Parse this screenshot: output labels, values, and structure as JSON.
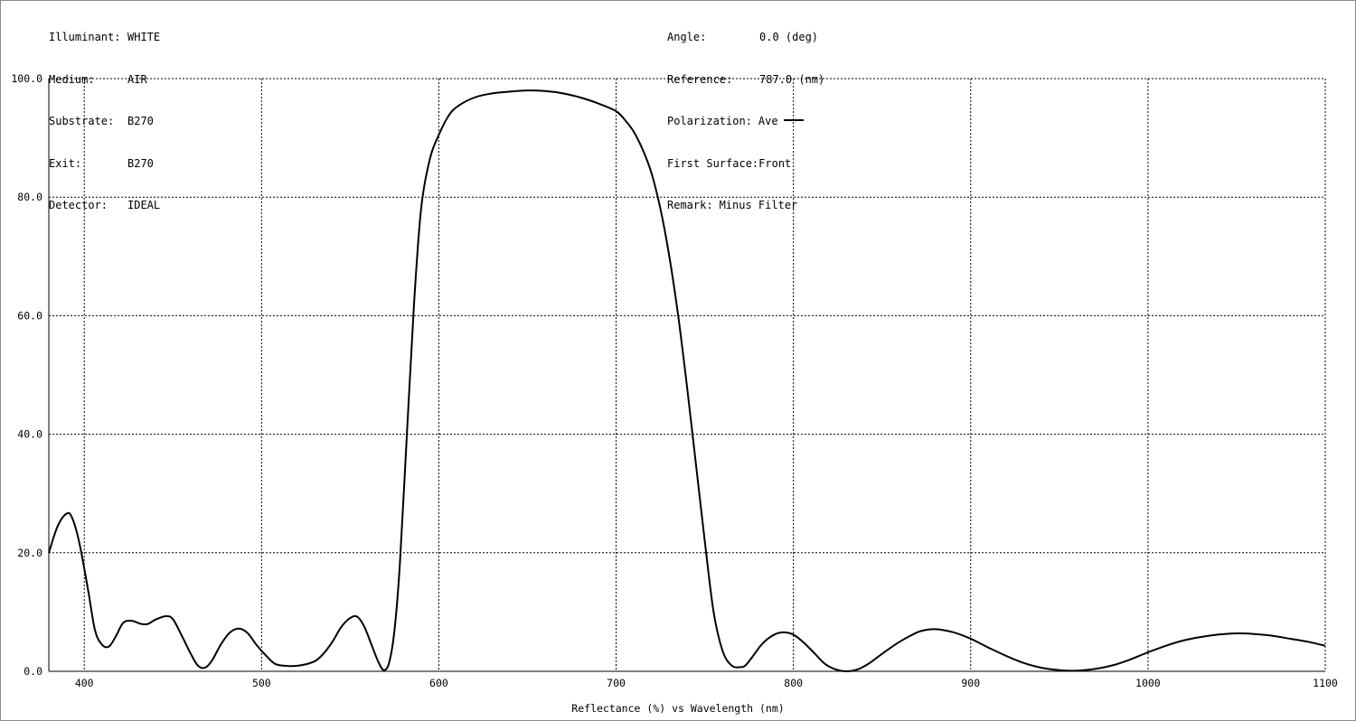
{
  "header_left": [
    {
      "key": "Illuminant:",
      "value": "WHITE"
    },
    {
      "key": "Medium:",
      "value": "AIR"
    },
    {
      "key": "Substrate:",
      "value": "B270"
    },
    {
      "key": "Exit:",
      "value": "B270"
    },
    {
      "key": "Detector:",
      "value": "IDEAL"
    }
  ],
  "header_right": {
    "angle": {
      "key": "Angle:",
      "value": "0.0 (deg)"
    },
    "reference": {
      "key": "Reference:",
      "value": "787.0 (nm)"
    },
    "polarization": {
      "key": "Polarization:",
      "value": "Ave"
    },
    "first_surface": {
      "key": "First Surface:",
      "value": "Front"
    },
    "remark": {
      "key": "Remark:",
      "value": "Minus Filter"
    }
  },
  "chart_data": {
    "type": "line",
    "xlabel": "Reflectance (%)  vs  Wavelength (nm)",
    "ylabel": "",
    "xlim": [
      380,
      1100
    ],
    "ylim": [
      0,
      100
    ],
    "x_ticks": [
      400,
      500,
      600,
      700,
      800,
      900,
      1000,
      1100
    ],
    "y_ticks": [
      0,
      20,
      40,
      60,
      80,
      100
    ],
    "y_tick_labels": [
      "0.0",
      "20.0",
      "40.0",
      "60.0",
      "80.0",
      "100.0"
    ],
    "grid": true,
    "line_color": "#000000",
    "series": [
      {
        "name": "Ave",
        "x": [
          380,
          385,
          390,
          393,
          397,
          402,
          406,
          410,
          414,
          418,
          422,
          427,
          432,
          436,
          440,
          446,
          450,
          455,
          460,
          464,
          468,
          472,
          477,
          482,
          487,
          492,
          497,
          503,
          508,
          515,
          522,
          530,
          535,
          540,
          545,
          550,
          554,
          558,
          562,
          566,
          569,
          572,
          575,
          578,
          582,
          586,
          590,
          595,
          600,
          605,
          610,
          620,
          630,
          640,
          650,
          660,
          670,
          680,
          690,
          700,
          705,
          710,
          715,
          720,
          725,
          730,
          735,
          740,
          745,
          750,
          755,
          760,
          765,
          770,
          773,
          777,
          782,
          787,
          792,
          797,
          801,
          806,
          812,
          818,
          824,
          830,
          836,
          842,
          848,
          854,
          860,
          866,
          872,
          880,
          890,
          900,
          910,
          920,
          930,
          940,
          950,
          960,
          970,
          980,
          990,
          1000,
          1010,
          1020,
          1030,
          1040,
          1050,
          1060,
          1070,
          1080,
          1090,
          1100
        ],
        "y": [
          20.0,
          24.5,
          26.6,
          26.0,
          22.0,
          14.0,
          7.0,
          4.5,
          4.2,
          6.0,
          8.2,
          8.5,
          8.0,
          8.0,
          8.7,
          9.3,
          8.8,
          6.0,
          3.0,
          1.0,
          0.6,
          1.8,
          4.5,
          6.5,
          7.2,
          6.5,
          4.5,
          2.5,
          1.2,
          0.9,
          1.0,
          1.7,
          3.0,
          5.0,
          7.5,
          9.0,
          9.2,
          7.5,
          4.5,
          1.5,
          0.2,
          1.5,
          7.0,
          18.0,
          40.0,
          62.0,
          78.0,
          86.5,
          90.5,
          93.5,
          95.2,
          96.8,
          97.5,
          97.8,
          98.0,
          97.9,
          97.5,
          96.8,
          95.8,
          94.5,
          93.0,
          91.0,
          88.0,
          84.0,
          78.0,
          70.0,
          60.0,
          48.0,
          35.0,
          22.0,
          10.0,
          3.5,
          1.0,
          0.7,
          1.0,
          2.5,
          4.5,
          5.8,
          6.5,
          6.5,
          6.0,
          4.8,
          3.0,
          1.2,
          0.3,
          0.0,
          0.3,
          1.2,
          2.5,
          3.8,
          5.0,
          6.0,
          6.8,
          7.1,
          6.6,
          5.5,
          4.0,
          2.6,
          1.4,
          0.6,
          0.2,
          0.1,
          0.4,
          1.0,
          2.0,
          3.2,
          4.3,
          5.2,
          5.8,
          6.2,
          6.4,
          6.3,
          6.0,
          5.5,
          5.0,
          4.3
        ]
      }
    ]
  }
}
